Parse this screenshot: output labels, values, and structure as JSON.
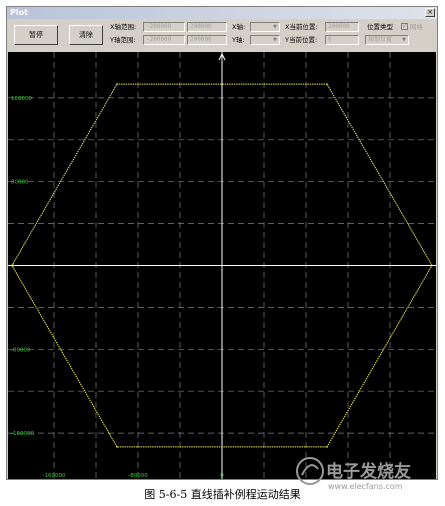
{
  "window": {
    "title": "Plot",
    "close_symbol": "×"
  },
  "toolbar": {
    "pause_label": "暂停",
    "clear_label": "清除",
    "xrange_label": "X轴范围:",
    "yrange_label": "Y轴范围:",
    "xrange_min": "-200000",
    "xrange_max": "200000",
    "yrange_min": "-200000",
    "yrange_max": "200000",
    "x_axis_label": "X轴:",
    "y_axis_label": "Y轴:",
    "x_cur_label": "X当前位置:",
    "y_cur_label": "Y当前位置:",
    "x_cur_value": "200000",
    "y_cur_value": "0",
    "pos_type_label": "位置类型",
    "pos_type_value": "规划位置",
    "grid_label": "网格",
    "grid_checked": "✓"
  },
  "chart_data": {
    "type": "line",
    "series": [
      {
        "x": [
          200000,
          100000,
          -100000,
          -200000,
          -100000,
          100000,
          200000
        ],
        "y": [
          0,
          173205,
          173205,
          0,
          -173205,
          -173205,
          0
        ]
      }
    ],
    "xlim": [
      -200000,
      200000
    ],
    "ylim": [
      -200000,
      200000
    ],
    "ytick_labels": [
      "160000",
      "80000",
      "0",
      "-80000",
      "-160000"
    ],
    "ytick_values": [
      160000,
      80000,
      0,
      -80000,
      -160000
    ],
    "xtick_labels": [
      "-160000",
      "-80000",
      "0"
    ],
    "xtick_values": [
      -160000,
      -80000,
      0
    ],
    "grid": true,
    "colors": {
      "background": "#000000",
      "curve": "#e8e850",
      "axes": "#ffffff",
      "grid": "#808080",
      "tick_text": "#33cc33"
    }
  },
  "caption": "图 5-6-5  直线插补例程运动结果",
  "watermark": {
    "text": "电子发烧友",
    "url": "www.elecfans.com"
  }
}
